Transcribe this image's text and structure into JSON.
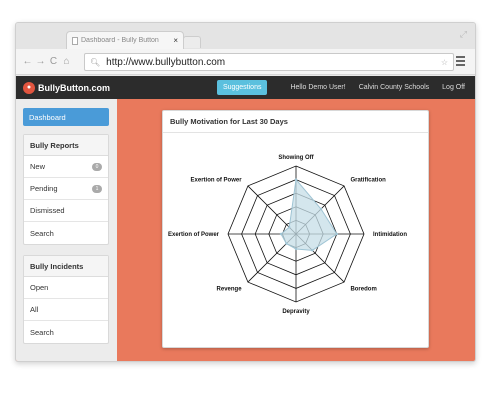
{
  "browser": {
    "tab_title": "Dashboard - Bully Button",
    "tab_close": "×",
    "url": "http://www.bullybutton.com"
  },
  "navbar": {
    "brand": "BullyButton.com",
    "suggestions": "Suggestions",
    "greeting": "Hello Demo User!",
    "org": "Calvin County Schools",
    "logout": "Log Off"
  },
  "sidebar": {
    "dashboard": "Dashboard",
    "reports": {
      "title": "Bully Reports",
      "items": [
        {
          "label": "New",
          "badge": "0"
        },
        {
          "label": "Pending",
          "badge": "1"
        },
        {
          "label": "Dismissed"
        },
        {
          "label": "Search"
        }
      ]
    },
    "incidents": {
      "title": "Bully Incidents",
      "items": [
        {
          "label": "Open"
        },
        {
          "label": "All"
        },
        {
          "label": "Search"
        }
      ]
    }
  },
  "card": {
    "title": "Bully Motivation for Last 30 Days"
  },
  "chart_data": {
    "type": "radar",
    "categories": [
      "Showing Off",
      "Gratification",
      "Intimidation",
      "Boredom",
      "Depravity",
      "Revenge",
      "Exertion of Power",
      "Exertion of Power"
    ],
    "values": [
      4,
      2.6,
      3,
      1.7,
      1.1,
      1,
      1.1,
      0.7
    ],
    "rlim": [
      0,
      5
    ],
    "grid": true,
    "fill_color": "#c6dde7",
    "stroke_color": "#9fc4d4"
  }
}
